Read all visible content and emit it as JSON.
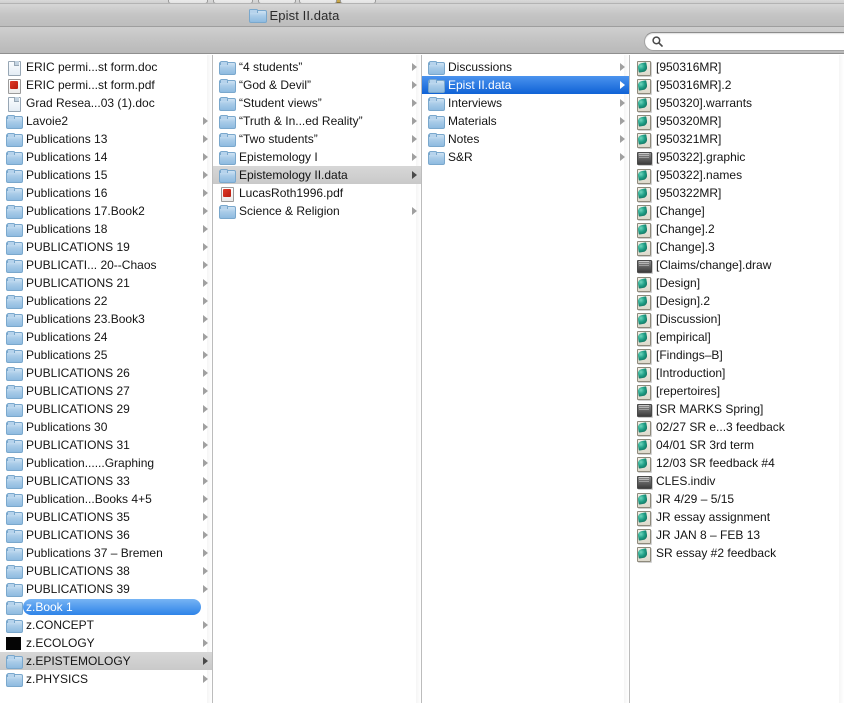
{
  "window": {
    "title": "Epist II.data",
    "title_icon": "folder-icon"
  },
  "toolbar": {
    "search": {
      "icon": "search-icon",
      "value": "",
      "placeholder": ""
    }
  },
  "columns": [
    {
      "name": "column-1",
      "items": [
        {
          "label": "ERIC permi...st form.doc",
          "icon": "document-icon",
          "kind": "doc",
          "arrow": false,
          "state": "normal"
        },
        {
          "label": "ERIC permi...st form.pdf",
          "icon": "pdf-document-icon",
          "kind": "pdf",
          "arrow": false,
          "state": "normal"
        },
        {
          "label": "Grad Resea...03 (1).doc",
          "icon": "document-icon",
          "kind": "doc",
          "arrow": false,
          "state": "normal"
        },
        {
          "label": "Lavoie2",
          "icon": "folder-icon",
          "kind": "folder",
          "arrow": true,
          "state": "normal"
        },
        {
          "label": "Publications 13",
          "icon": "folder-icon",
          "kind": "folder",
          "arrow": true,
          "state": "normal"
        },
        {
          "label": "Publications 14",
          "icon": "folder-icon",
          "kind": "folder",
          "arrow": true,
          "state": "normal"
        },
        {
          "label": "Publications 15",
          "icon": "folder-icon",
          "kind": "folder",
          "arrow": true,
          "state": "normal"
        },
        {
          "label": "Publications 16",
          "icon": "folder-icon",
          "kind": "folder",
          "arrow": true,
          "state": "normal"
        },
        {
          "label": "Publications 17.Book2",
          "icon": "folder-icon",
          "kind": "folder",
          "arrow": true,
          "state": "normal"
        },
        {
          "label": "Publications 18",
          "icon": "folder-icon",
          "kind": "folder",
          "arrow": true,
          "state": "normal"
        },
        {
          "label": "PUBLICATIONS 19",
          "icon": "folder-icon",
          "kind": "folder",
          "arrow": true,
          "state": "normal"
        },
        {
          "label": "PUBLICATI... 20--Chaos",
          "icon": "folder-icon",
          "kind": "folder",
          "arrow": true,
          "state": "normal"
        },
        {
          "label": "PUBLICATIONS 21",
          "icon": "folder-icon",
          "kind": "folder",
          "arrow": true,
          "state": "normal"
        },
        {
          "label": "Publications 22",
          "icon": "folder-icon",
          "kind": "folder",
          "arrow": true,
          "state": "normal"
        },
        {
          "label": "Publications 23.Book3",
          "icon": "folder-icon",
          "kind": "folder",
          "arrow": true,
          "state": "normal"
        },
        {
          "label": "Publications 24",
          "icon": "folder-icon",
          "kind": "folder",
          "arrow": true,
          "state": "normal"
        },
        {
          "label": "Publications 25",
          "icon": "folder-icon",
          "kind": "folder",
          "arrow": true,
          "state": "normal"
        },
        {
          "label": "PUBLICATIONS 26",
          "icon": "folder-icon",
          "kind": "folder",
          "arrow": true,
          "state": "normal"
        },
        {
          "label": "PUBLICATIONS 27",
          "icon": "folder-icon",
          "kind": "folder",
          "arrow": true,
          "state": "normal"
        },
        {
          "label": "PUBLICATIONS 29",
          "icon": "folder-icon",
          "kind": "folder",
          "arrow": true,
          "state": "normal"
        },
        {
          "label": "Publications 30",
          "icon": "folder-icon",
          "kind": "folder",
          "arrow": true,
          "state": "normal"
        },
        {
          "label": "PUBLICATIONS 31",
          "icon": "folder-icon",
          "kind": "folder",
          "arrow": true,
          "state": "normal"
        },
        {
          "label": "Publication......Graphing",
          "icon": "folder-icon",
          "kind": "folder",
          "arrow": true,
          "state": "normal"
        },
        {
          "label": "PUBLICATIONS 33",
          "icon": "folder-icon",
          "kind": "folder",
          "arrow": true,
          "state": "normal"
        },
        {
          "label": "Publication...Books 4+5",
          "icon": "folder-icon",
          "kind": "folder",
          "arrow": true,
          "state": "normal"
        },
        {
          "label": "PUBLICATIONS 35",
          "icon": "folder-icon",
          "kind": "folder",
          "arrow": true,
          "state": "normal"
        },
        {
          "label": "PUBLICATIONS 36",
          "icon": "folder-icon",
          "kind": "folder",
          "arrow": true,
          "state": "normal"
        },
        {
          "label": "Publications 37 – Bremen",
          "icon": "folder-icon",
          "kind": "folder",
          "arrow": true,
          "state": "normal"
        },
        {
          "label": "PUBLICATIONS 38",
          "icon": "folder-icon",
          "kind": "folder",
          "arrow": true,
          "state": "normal"
        },
        {
          "label": "PUBLICATIONS 39",
          "icon": "folder-icon",
          "kind": "folder",
          "arrow": true,
          "state": "normal"
        },
        {
          "label": "z.Book 1",
          "icon": "folder-icon",
          "kind": "folder",
          "arrow": true,
          "state": "selected-pill"
        },
        {
          "label": "z.CONCEPT",
          "icon": "folder-icon",
          "kind": "folder",
          "arrow": true,
          "state": "normal"
        },
        {
          "label": "z.ECOLOGY",
          "icon": "black-icon",
          "kind": "black",
          "arrow": true,
          "state": "normal"
        },
        {
          "label": "z.EPISTEMOLOGY",
          "icon": "folder-icon",
          "kind": "folder",
          "arrow": true,
          "state": "selected-inactive"
        },
        {
          "label": "z.PHYSICS",
          "icon": "folder-icon",
          "kind": "folder",
          "arrow": true,
          "state": "normal"
        }
      ]
    },
    {
      "name": "column-2",
      "items": [
        {
          "label": "“4 students”",
          "icon": "folder-icon",
          "kind": "folder",
          "arrow": true,
          "state": "normal"
        },
        {
          "label": "“God & Devil”",
          "icon": "folder-icon",
          "kind": "folder",
          "arrow": true,
          "state": "normal"
        },
        {
          "label": "“Student views”",
          "icon": "folder-icon",
          "kind": "folder",
          "arrow": true,
          "state": "normal"
        },
        {
          "label": "“Truth & In...ed Reality”",
          "icon": "folder-icon",
          "kind": "folder",
          "arrow": true,
          "state": "normal"
        },
        {
          "label": "“Two students”",
          "icon": "folder-icon",
          "kind": "folder",
          "arrow": true,
          "state": "normal"
        },
        {
          "label": "Epistemology I",
          "icon": "folder-icon",
          "kind": "folder",
          "arrow": true,
          "state": "normal"
        },
        {
          "label": "Epistemology II.data",
          "icon": "folder-icon",
          "kind": "folder",
          "arrow": true,
          "state": "selected-inactive"
        },
        {
          "label": "LucasRoth1996.pdf",
          "icon": "pdf-document-icon",
          "kind": "pdf",
          "arrow": false,
          "state": "normal"
        },
        {
          "label": "Science & Religion",
          "icon": "folder-icon",
          "kind": "folder",
          "arrow": true,
          "state": "normal"
        }
      ]
    },
    {
      "name": "column-3",
      "items": [
        {
          "label": "Discussions",
          "icon": "folder-icon",
          "kind": "folder",
          "arrow": true,
          "state": "normal"
        },
        {
          "label": "Epist II.data",
          "icon": "folder-icon",
          "kind": "folder",
          "arrow": true,
          "state": "selected-active"
        },
        {
          "label": "Interviews",
          "icon": "folder-icon",
          "kind": "folder",
          "arrow": true,
          "state": "normal"
        },
        {
          "label": "Materials",
          "icon": "folder-icon",
          "kind": "folder",
          "arrow": true,
          "state": "normal"
        },
        {
          "label": "Notes",
          "icon": "folder-icon",
          "kind": "folder",
          "arrow": true,
          "state": "normal"
        },
        {
          "label": "S&R",
          "icon": "folder-icon",
          "kind": "folder",
          "arrow": true,
          "state": "normal"
        }
      ]
    },
    {
      "name": "column-4",
      "items": [
        {
          "label": "[950316MR]",
          "icon": "classic-document-icon",
          "kind": "teal",
          "arrow": false,
          "state": "normal"
        },
        {
          "label": "[950316MR].2",
          "icon": "classic-document-icon",
          "kind": "teal",
          "arrow": false,
          "state": "normal"
        },
        {
          "label": "[950320].warrants",
          "icon": "classic-document-icon",
          "kind": "teal",
          "arrow": false,
          "state": "normal"
        },
        {
          "label": "[950320MR]",
          "icon": "classic-document-icon",
          "kind": "teal",
          "arrow": false,
          "state": "normal"
        },
        {
          "label": "[950321MR]",
          "icon": "classic-document-icon",
          "kind": "teal",
          "arrow": false,
          "state": "normal"
        },
        {
          "label": "[950322].graphic",
          "icon": "graphic-document-icon",
          "kind": "dark",
          "arrow": false,
          "state": "normal"
        },
        {
          "label": "[950322].names",
          "icon": "classic-document-icon",
          "kind": "teal",
          "arrow": false,
          "state": "normal"
        },
        {
          "label": "[950322MR]",
          "icon": "classic-document-icon",
          "kind": "teal",
          "arrow": false,
          "state": "normal"
        },
        {
          "label": "[Change]",
          "icon": "classic-document-icon",
          "kind": "teal",
          "arrow": false,
          "state": "normal"
        },
        {
          "label": "[Change].2",
          "icon": "classic-document-icon",
          "kind": "teal",
          "arrow": false,
          "state": "normal"
        },
        {
          "label": "[Change].3",
          "icon": "classic-document-icon",
          "kind": "teal",
          "arrow": false,
          "state": "normal"
        },
        {
          "label": "[Claims/change].draw",
          "icon": "graphic-document-icon",
          "kind": "dark",
          "arrow": false,
          "state": "normal"
        },
        {
          "label": "[Design]",
          "icon": "classic-document-icon",
          "kind": "teal",
          "arrow": false,
          "state": "normal"
        },
        {
          "label": "[Design].2",
          "icon": "classic-document-icon",
          "kind": "teal",
          "arrow": false,
          "state": "normal"
        },
        {
          "label": "[Discussion]",
          "icon": "classic-document-icon",
          "kind": "teal",
          "arrow": false,
          "state": "normal"
        },
        {
          "label": "[empirical]",
          "icon": "classic-document-icon",
          "kind": "teal",
          "arrow": false,
          "state": "normal"
        },
        {
          "label": "[Findings–B]",
          "icon": "classic-document-icon",
          "kind": "teal",
          "arrow": false,
          "state": "normal"
        },
        {
          "label": "[Introduction]",
          "icon": "classic-document-icon",
          "kind": "teal",
          "arrow": false,
          "state": "normal"
        },
        {
          "label": "[repertoires]",
          "icon": "classic-document-icon",
          "kind": "teal",
          "arrow": false,
          "state": "normal"
        },
        {
          "label": "[SR MARKS Spring]",
          "icon": "graphic-document-icon",
          "kind": "dark",
          "arrow": false,
          "state": "normal"
        },
        {
          "label": "02/27 SR e...3 feedback",
          "icon": "classic-document-icon",
          "kind": "teal",
          "arrow": false,
          "state": "normal"
        },
        {
          "label": "04/01 SR 3rd term",
          "icon": "classic-document-icon",
          "kind": "teal",
          "arrow": false,
          "state": "normal"
        },
        {
          "label": "12/03 SR feedback #4",
          "icon": "classic-document-icon",
          "kind": "teal",
          "arrow": false,
          "state": "normal"
        },
        {
          "label": "CLES.indiv",
          "icon": "graphic-document-icon",
          "kind": "dark",
          "arrow": false,
          "state": "normal"
        },
        {
          "label": "JR 4/29 – 5/15",
          "icon": "classic-document-icon",
          "kind": "teal",
          "arrow": false,
          "state": "normal"
        },
        {
          "label": "JR essay assignment",
          "icon": "classic-document-icon",
          "kind": "teal",
          "arrow": false,
          "state": "normal"
        },
        {
          "label": "JR JAN 8 – FEB 13",
          "icon": "classic-document-icon",
          "kind": "teal",
          "arrow": false,
          "state": "normal"
        },
        {
          "label": "SR essay  #2 feedback",
          "icon": "classic-document-icon",
          "kind": "teal",
          "arrow": false,
          "state": "normal"
        }
      ]
    }
  ],
  "colors": {
    "selection_active": "#1f6fdc",
    "selection_inactive": "#cfcfcf",
    "titlebar": "#c4c4c4",
    "window_background": "#ffffff"
  }
}
